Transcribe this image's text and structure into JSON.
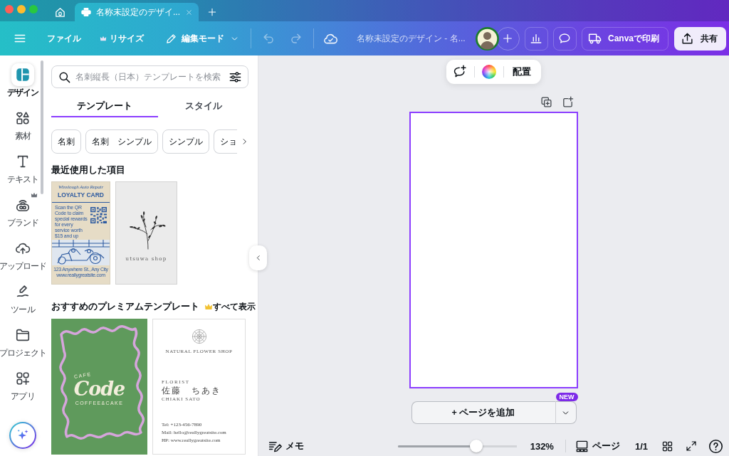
{
  "browser": {
    "tabs": [
      {
        "kind": "home",
        "selected": false
      },
      {
        "kind": "document",
        "label": "名称未設定のデザイ...",
        "selected": true
      }
    ]
  },
  "toolbar": {
    "menus": [
      {
        "label": "ファイル",
        "kind": "plain"
      },
      {
        "label": "リサイズ",
        "kind": "premium"
      },
      {
        "label": "編集モード",
        "kind": "dropdown"
      }
    ],
    "undo": {
      "disabled": true
    },
    "redo": {
      "disabled": true
    },
    "title": "名称未設定のデザイン - 名...",
    "print": {
      "label": "Canvaで印刷"
    },
    "share": {
      "label": "共有"
    }
  },
  "rail": [
    {
      "label": "デザイン",
      "selected": true,
      "premium": false
    },
    {
      "label": "素材",
      "selected": false,
      "premium": false
    },
    {
      "label": "テキスト",
      "selected": false,
      "premium": false
    },
    {
      "label": "ブランド",
      "selected": false,
      "premium": true
    },
    {
      "label": "アップロード",
      "selected": false,
      "premium": false
    },
    {
      "label": "ツール",
      "selected": false,
      "premium": false
    },
    {
      "label": "プロジェクト",
      "selected": false,
      "premium": false
    },
    {
      "label": "アプリ",
      "selected": false,
      "premium": false
    }
  ],
  "panel": {
    "search": {
      "placeholder": "名刺縦長（日本）テンプレートを検索"
    },
    "tabs": [
      {
        "label": "テンプレート",
        "selected": true
      },
      {
        "label": "スタイル",
        "selected": false
      }
    ],
    "chips": [
      "名刺",
      "名刺　シンプル",
      "シンプル",
      "ショ"
    ],
    "recent": {
      "title": "最近使用した項目",
      "items": [
        {
          "kind": "loyalty",
          "heading": "Winslough Auto Repair",
          "title": "LOYALTY CARD",
          "body": "Scan the QR Code to claim special rewards for every service worth $15 and up",
          "address": "123 Anywhere St., Any City",
          "website": "www.reallygreatsite.com"
        },
        {
          "kind": "botanical",
          "caption": "utsuwa shop"
        }
      ]
    },
    "premium": {
      "title": "おすすめのプレミアムテンプレート",
      "see_all": "すべて表示",
      "items": [
        {
          "kind": "cafe",
          "overline": "CAFE",
          "title": "Code",
          "subtitle": "COFFEE&CAKE"
        },
        {
          "kind": "florist",
          "shop": "NATURAL FLOWER SHOP",
          "role": "FLORIST",
          "name": "佐藤　ちあき",
          "romaji": "CHIAKI SATO",
          "tel": "Tel: +123-456-7890",
          "mail": "Mail: hello@reallygreatsite.com",
          "hp": "HP: www.reallygreatsite.com"
        }
      ]
    }
  },
  "canvas": {
    "context_toolbar": {
      "label": "配置"
    },
    "page": {
      "selected": true
    },
    "add_page": {
      "label": "+ ページを追加",
      "badge": "NEW"
    }
  },
  "footer": {
    "notes": "メモ",
    "zoom": {
      "level": 0.66,
      "reading": "132%"
    },
    "pages": "ページ",
    "page_count": "1/1"
  }
}
